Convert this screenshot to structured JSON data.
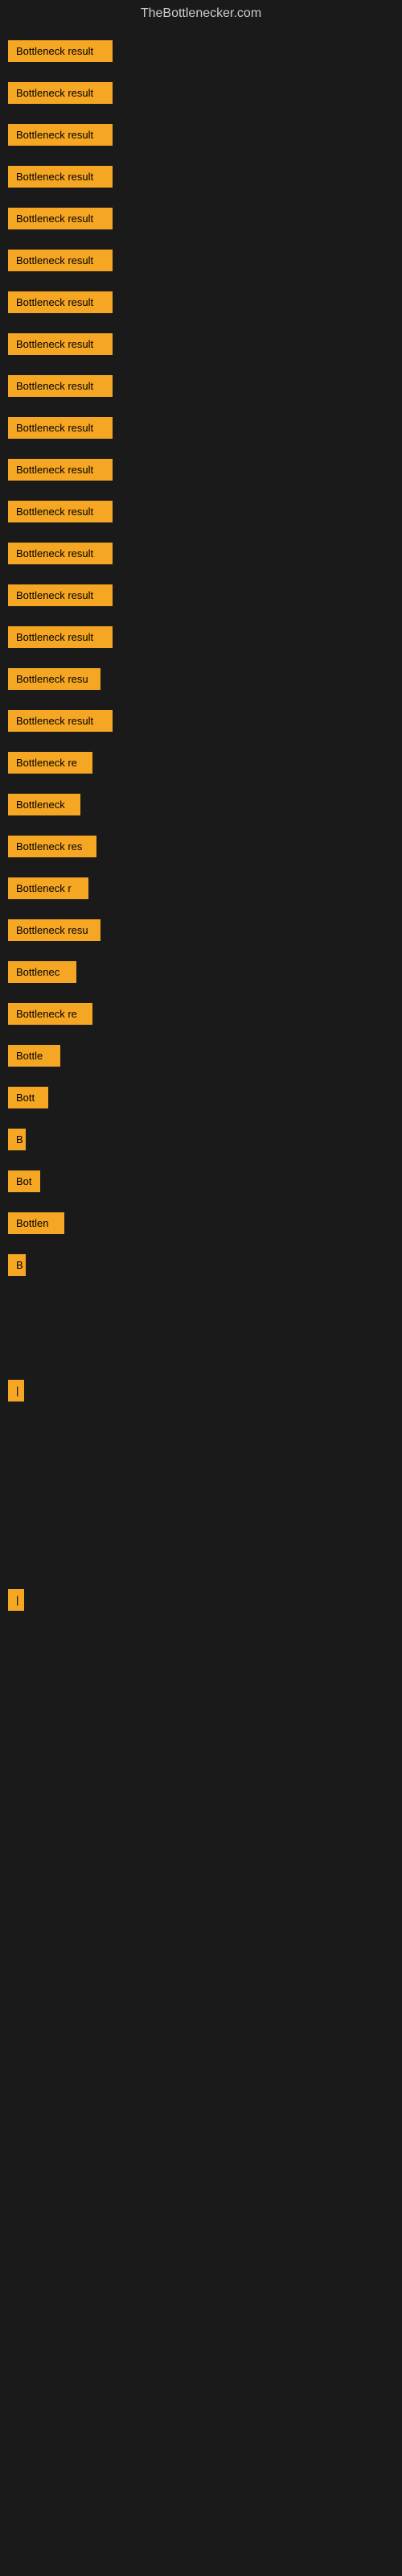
{
  "site": {
    "title": "TheBottlenecker.com"
  },
  "items": [
    {
      "label": "Bottleneck result",
      "width": 130,
      "bar_width": 0
    },
    {
      "label": "Bottleneck result",
      "width": 130,
      "bar_width": 0
    },
    {
      "label": "Bottleneck result",
      "width": 130,
      "bar_width": 0
    },
    {
      "label": "Bottleneck result",
      "width": 130,
      "bar_width": 0
    },
    {
      "label": "Bottleneck result",
      "width": 130,
      "bar_width": 0
    },
    {
      "label": "Bottleneck result",
      "width": 130,
      "bar_width": 0
    },
    {
      "label": "Bottleneck result",
      "width": 130,
      "bar_width": 0
    },
    {
      "label": "Bottleneck result",
      "width": 130,
      "bar_width": 0
    },
    {
      "label": "Bottleneck result",
      "width": 130,
      "bar_width": 0
    },
    {
      "label": "Bottleneck result",
      "width": 130,
      "bar_width": 0
    },
    {
      "label": "Bottleneck result",
      "width": 130,
      "bar_width": 0
    },
    {
      "label": "Bottleneck result",
      "width": 130,
      "bar_width": 0
    },
    {
      "label": "Bottleneck result",
      "width": 130,
      "bar_width": 0
    },
    {
      "label": "Bottleneck result",
      "width": 130,
      "bar_width": 0
    },
    {
      "label": "Bottleneck result",
      "width": 130,
      "bar_width": 0
    },
    {
      "label": "Bottleneck resu",
      "width": 115,
      "bar_width": 0
    },
    {
      "label": "Bottleneck result",
      "width": 130,
      "bar_width": 0
    },
    {
      "label": "Bottleneck re",
      "width": 105,
      "bar_width": 0
    },
    {
      "label": "Bottleneck",
      "width": 90,
      "bar_width": 0
    },
    {
      "label": "Bottleneck res",
      "width": 110,
      "bar_width": 0
    },
    {
      "label": "Bottleneck r",
      "width": 100,
      "bar_width": 0
    },
    {
      "label": "Bottleneck resu",
      "width": 115,
      "bar_width": 0
    },
    {
      "label": "Bottlenec",
      "width": 85,
      "bar_width": 0
    },
    {
      "label": "Bottleneck re",
      "width": 105,
      "bar_width": 0
    },
    {
      "label": "Bottle",
      "width": 65,
      "bar_width": 0
    },
    {
      "label": "Bott",
      "width": 50,
      "bar_width": 0
    },
    {
      "label": "B",
      "width": 22,
      "bar_width": 0
    },
    {
      "label": "Bot",
      "width": 40,
      "bar_width": 0
    },
    {
      "label": "Bottlen",
      "width": 70,
      "bar_width": 0
    },
    {
      "label": "B",
      "width": 22,
      "bar_width": 0
    },
    {
      "label": "",
      "width": 0,
      "bar_width": 0
    },
    {
      "label": "",
      "width": 0,
      "bar_width": 0
    },
    {
      "label": "|",
      "width": 12,
      "bar_width": 0
    },
    {
      "label": "",
      "width": 0,
      "bar_width": 0
    },
    {
      "label": "",
      "width": 0,
      "bar_width": 0
    },
    {
      "label": "",
      "width": 0,
      "bar_width": 0
    },
    {
      "label": "",
      "width": 0,
      "bar_width": 0
    },
    {
      "label": "|",
      "width": 12,
      "bar_width": 0
    }
  ]
}
